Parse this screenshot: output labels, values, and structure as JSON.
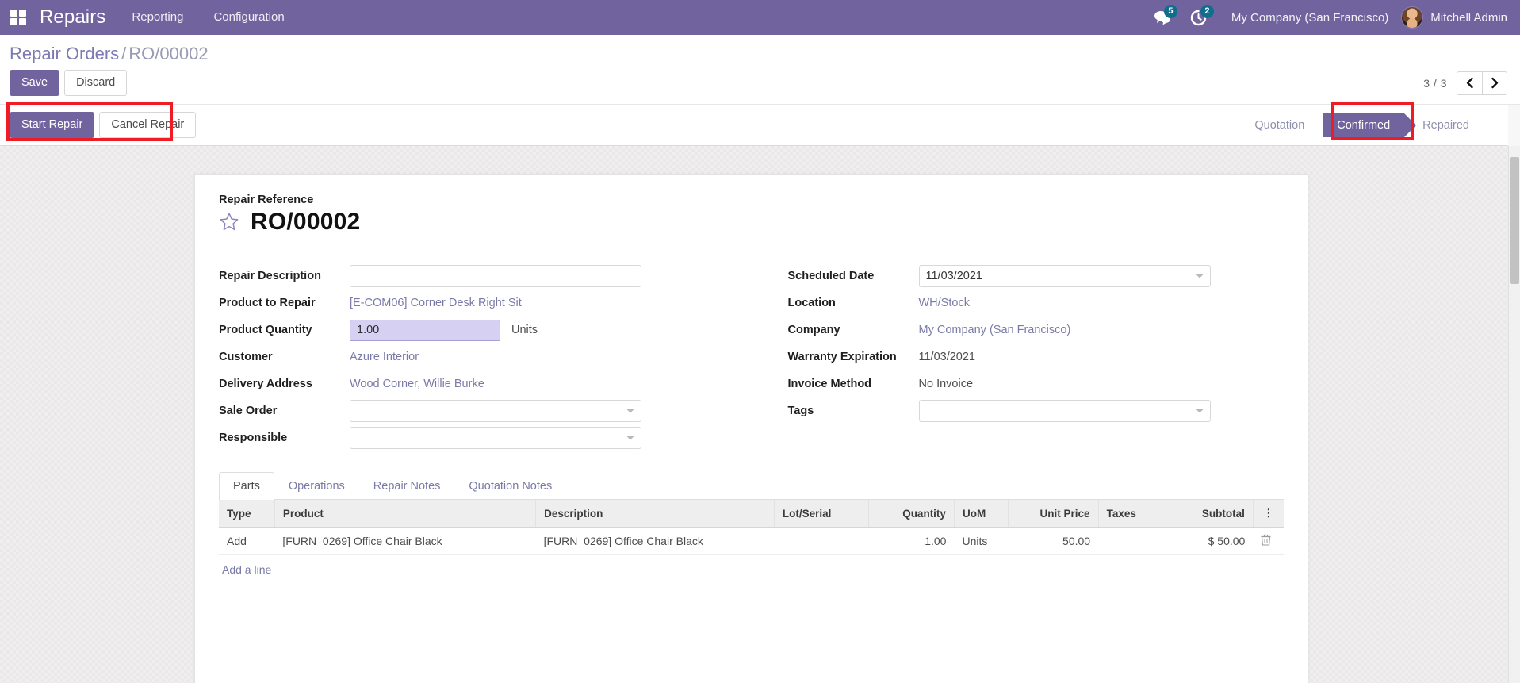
{
  "navbar": {
    "apps_icon": "grid-apps-icon",
    "brand": "Repairs",
    "menus": [
      {
        "label": "Reporting"
      },
      {
        "label": "Configuration"
      }
    ],
    "messages_icon": "chat-bubbles-icon",
    "messages_count": "5",
    "activities_icon": "clock-activity-icon",
    "activities_count": "2",
    "company": "My Company (San Francisco)",
    "user": "Mitchell Admin",
    "avatar_icon": "user-avatar",
    "accent_color": "#71639e",
    "badge_color": "#0e6e8c"
  },
  "control_panel": {
    "breadcrumb_parent": "Repair Orders",
    "breadcrumb_sep": "/",
    "breadcrumb_current": "RO/00002",
    "save_label": "Save",
    "discard_label": "Discard",
    "pager_text": "3 / 3",
    "prev_icon": "chevron-left-icon",
    "next_icon": "chevron-right-icon"
  },
  "action_bar": {
    "start_repair_label": "Start Repair",
    "cancel_repair_label": "Cancel Repair",
    "statuses": [
      {
        "label": "Quotation",
        "active": false
      },
      {
        "label": "Confirmed",
        "active": true
      },
      {
        "label": "Repaired",
        "active": false
      }
    ],
    "highlight_color": "#ee1c25"
  },
  "form": {
    "reference_label": "Repair Reference",
    "reference_value": "RO/00002",
    "star_icon": "star-outline-icon",
    "left_fields": [
      {
        "label": "Repair Description",
        "value": "",
        "type": "input",
        "placeholder": ""
      },
      {
        "label": "Product to Repair",
        "value": "[E-COM06] Corner Desk Right Sit",
        "type": "link"
      },
      {
        "label": "Product Quantity",
        "value": "1.00",
        "type": "qty",
        "suffix": "Units"
      },
      {
        "label": "Customer",
        "value": "Azure Interior",
        "type": "link"
      },
      {
        "label": "Delivery Address",
        "value": "Wood Corner, Willie Burke",
        "type": "link"
      },
      {
        "label": "Sale Order",
        "value": "",
        "type": "select",
        "placeholder": ""
      },
      {
        "label": "Responsible",
        "value": "",
        "type": "select",
        "placeholder": ""
      }
    ],
    "right_fields": [
      {
        "label": "Scheduled Date",
        "value": "11/03/2021",
        "type": "select"
      },
      {
        "label": "Location",
        "value": "WH/Stock",
        "type": "link"
      },
      {
        "label": "Company",
        "value": "My Company (San Francisco)",
        "type": "link"
      },
      {
        "label": "Warranty Expiration",
        "value": "11/03/2021",
        "type": "plain"
      },
      {
        "label": "Invoice Method",
        "value": "No Invoice",
        "type": "plain"
      },
      {
        "label": "Tags",
        "value": "",
        "type": "select",
        "placeholder": ""
      }
    ]
  },
  "notebook": {
    "tabs": [
      {
        "label": "Parts",
        "active": true
      },
      {
        "label": "Operations",
        "active": false
      },
      {
        "label": "Repair Notes",
        "active": false
      },
      {
        "label": "Quotation Notes",
        "active": false
      }
    ],
    "table": {
      "columns": [
        {
          "label": "Type",
          "align": "left"
        },
        {
          "label": "Product",
          "align": "left"
        },
        {
          "label": "Description",
          "align": "left"
        },
        {
          "label": "Lot/Serial",
          "align": "left"
        },
        {
          "label": "Quantity",
          "align": "right"
        },
        {
          "label": "UoM",
          "align": "left"
        },
        {
          "label": "Unit Price",
          "align": "right"
        },
        {
          "label": "Taxes",
          "align": "left"
        },
        {
          "label": "Subtotal",
          "align": "right"
        },
        {
          "label": "",
          "align": "center",
          "icon": "optional-columns-icon"
        }
      ],
      "rows": [
        {
          "type": "Add",
          "product": "[FURN_0269] Office Chair Black",
          "description": "[FURN_0269] Office Chair Black",
          "lot_serial": "",
          "quantity": "1.00",
          "uom": "Units",
          "unit_price": "50.00",
          "taxes": "",
          "subtotal": "$ 50.00",
          "delete_icon": "trash-icon"
        }
      ],
      "add_line_label": "Add a line"
    }
  }
}
